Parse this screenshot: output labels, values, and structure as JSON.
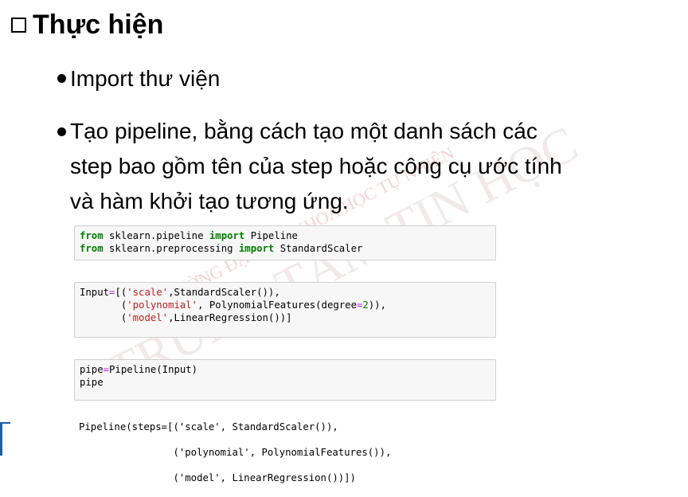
{
  "watermark": {
    "line1": "TRƯỜNG ĐẠI HỌC KHOA HỌC TỰ NHIÊN",
    "line2": "TRUNG TÂM TIN HỌC"
  },
  "heading": {
    "title": "Thực hiện"
  },
  "bullets": [
    {
      "text": "Import thư viện"
    },
    {
      "text": "Tạo pipeline, bằng cách tạo một danh sách các step bao gồm tên của step hoặc công cụ ước tính và hàm khởi tạo tương ứng."
    }
  ],
  "bullet2_lines": [
    "Tạo pipeline, bằng cách tạo một danh sách các",
    "step bao gồm tên của step hoặc công cụ ước tính",
    "và hàm khởi tạo tương ứng."
  ],
  "code_cells": [
    {
      "lines": [
        "from sklearn.pipeline import Pipeline",
        "from sklearn.preprocessing import StandardScaler"
      ]
    },
    {
      "lines": [
        "Input=[('scale',StandardScaler()),",
        "       ('polynomial', PolynomialFeatures(degree=2)),",
        "       ('model',LinearRegression())]"
      ]
    },
    {
      "lines": [
        "pipe=Pipeline(Input)",
        "pipe"
      ]
    }
  ],
  "output": {
    "lines": [
      "Pipeline(steps=[('scale', StandardScaler()),",
      "                ('polynomial', PolynomialFeatures()),",
      "                ('model', LinearRegression())])"
    ]
  }
}
